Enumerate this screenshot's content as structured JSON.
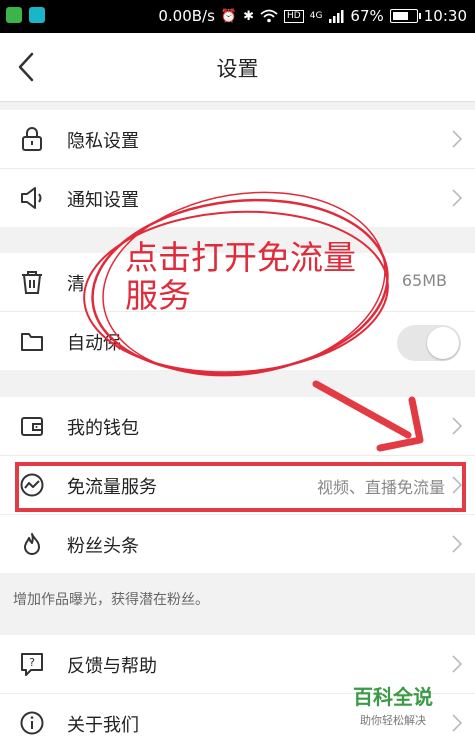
{
  "status_bar": {
    "network_speed": "0.00B/s",
    "hd_label": "HD",
    "network_type": "4G",
    "battery": "67%",
    "time": "10:30"
  },
  "header": {
    "title": "设置"
  },
  "groups": [
    {
      "items": [
        {
          "label": "隐私设置",
          "icon": "lock-icon"
        },
        {
          "label": "通知设置",
          "icon": "speaker-icon"
        }
      ]
    },
    {
      "items": [
        {
          "label": "清",
          "icon": "trash-icon",
          "value": "65MB"
        },
        {
          "label": "自动保",
          "icon": "folder-icon",
          "toggle": false
        }
      ]
    },
    {
      "items": [
        {
          "label": "我的钱包",
          "icon": "wallet-icon"
        },
        {
          "label": "免流量服务",
          "icon": "trend-circle-icon",
          "value": "视频、直播免流量"
        },
        {
          "label": "粉丝头条",
          "icon": "flame-icon"
        }
      ]
    },
    {
      "items": [
        {
          "label": "反馈与帮助",
          "icon": "question-icon"
        },
        {
          "label": "关于我们",
          "icon": "info-icon"
        }
      ]
    }
  ],
  "hint": "增加作品曝光，获得潜在粉丝。",
  "annotation": {
    "text": "点击打开免流量服务",
    "color": "#e02b3a"
  },
  "watermark": {
    "main": "百科全说",
    "sub": "助你轻松解决"
  }
}
